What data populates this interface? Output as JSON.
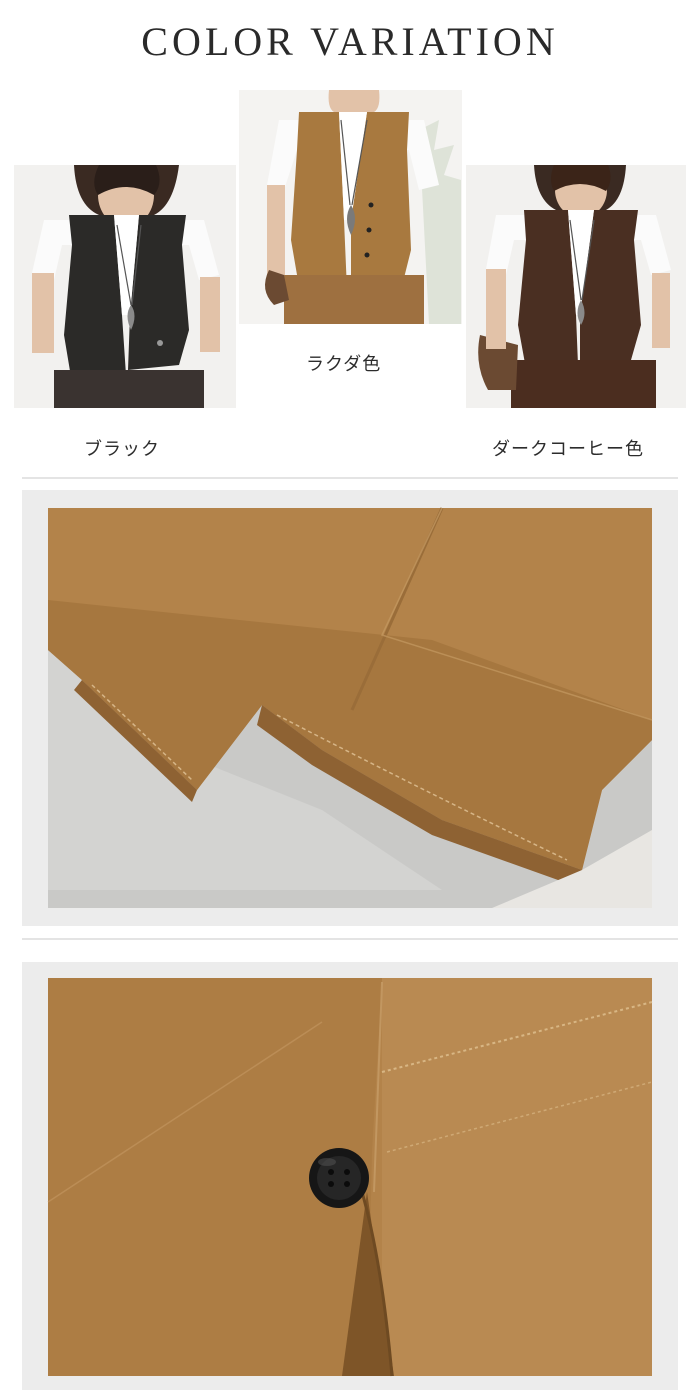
{
  "header": {
    "title": "COLOR VARIATION"
  },
  "colors": [
    {
      "label": "ブラック",
      "swatch": "#2b2a28"
    },
    {
      "label": "ラクダ色",
      "swatch": "#a8793f"
    },
    {
      "label": "ダークコーヒー色",
      "swatch": "#4a2f22"
    }
  ],
  "palette": {
    "camel_fabric": "#b3834a",
    "camel_shadow": "#8e6233",
    "floor_gray": "#c9c9c7",
    "button_black": "#161616",
    "frame_gray": "#ececec"
  }
}
